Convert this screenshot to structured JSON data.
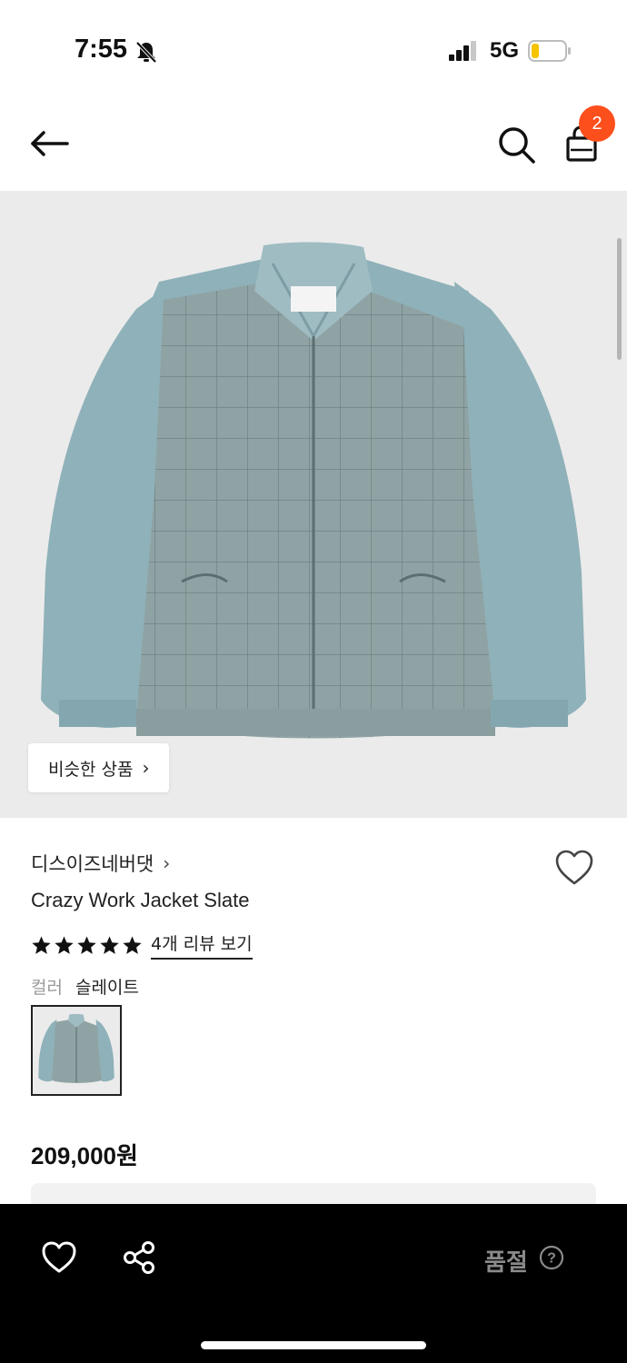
{
  "status_bar": {
    "time": "7:55",
    "network": "5G",
    "icons": [
      "bell-muted-icon",
      "signal-icon",
      "battery-icon"
    ],
    "battery_color": "#f5c400"
  },
  "nav": {
    "icons": [
      "back-arrow-icon",
      "search-icon",
      "shopping-bag-icon"
    ],
    "cart_count": "2",
    "badge_color": "#fd4f1c"
  },
  "product_image": {
    "similar_products_label": "비슷한 상품"
  },
  "product": {
    "brand": "디스이즈네버댓",
    "title": "Crazy Work Jacket Slate",
    "rating_stars": 5,
    "review_link": "4개 리뷰 보기",
    "color_label": "컬러",
    "color_value": "슬레이트",
    "price": "209,000원"
  },
  "bottom_bar": {
    "soldout_label": "품절",
    "icons": [
      "heart-icon",
      "share-icon",
      "help-icon"
    ]
  }
}
